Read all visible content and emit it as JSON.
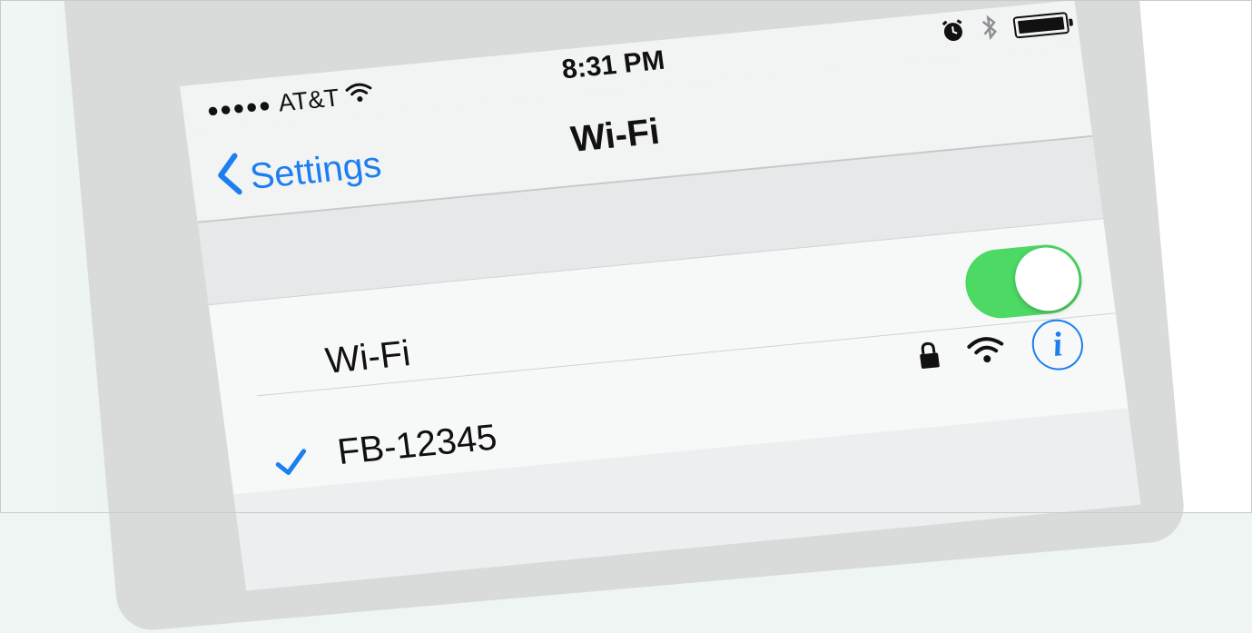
{
  "status_bar": {
    "signal_dots": "●●●●●",
    "carrier": "AT&T",
    "time": "8:31 PM"
  },
  "nav": {
    "back_label": "Settings",
    "title": "Wi-Fi"
  },
  "wifi_toggle": {
    "label": "Wi-Fi",
    "on": true,
    "on_color": "#4cd964"
  },
  "network": {
    "name": "FB-12345",
    "selected": true,
    "secured": true
  },
  "colors": {
    "accent": "#1d7ef0"
  },
  "icons": [
    "wifi-icon",
    "alarm-icon",
    "bluetooth-icon",
    "battery-icon",
    "chevron-left-icon",
    "checkmark-icon",
    "lock-icon",
    "info-icon"
  ],
  "info_glyph": "i"
}
